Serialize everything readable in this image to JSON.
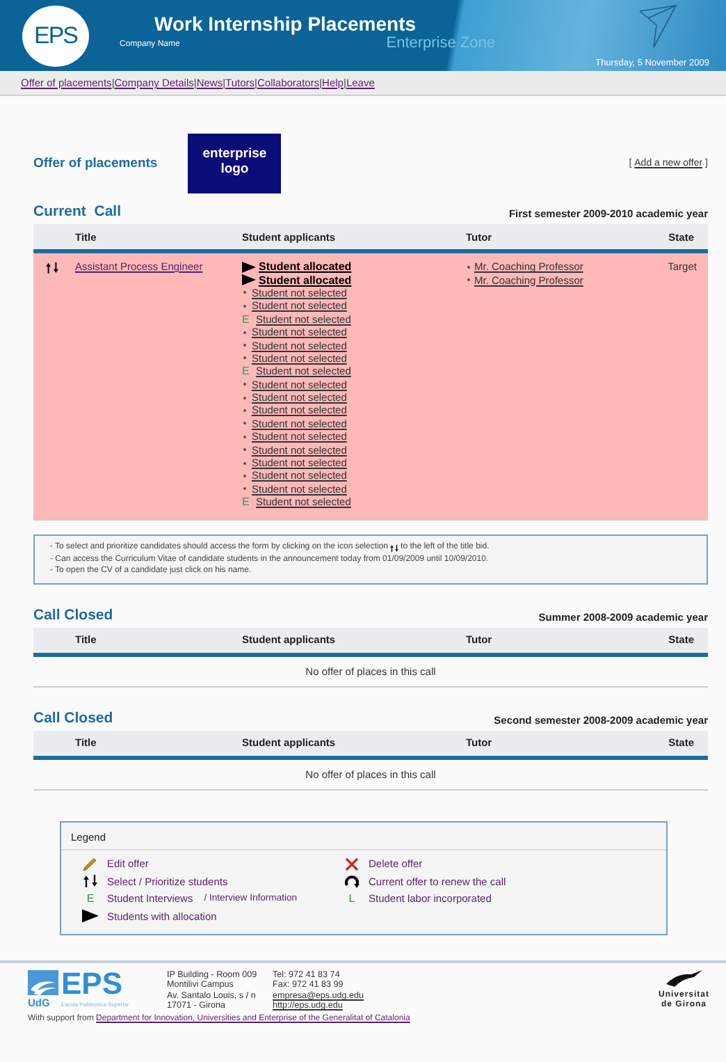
{
  "header": {
    "logo": "EPS",
    "title": "Work Internship Placements",
    "subtitle": "Enterprise Zone",
    "company": "Company Name",
    "date": "Thursday, 5 November 2009"
  },
  "nav": [
    {
      "label": "Offer of placements",
      "separator": "|"
    },
    {
      "label": "Company Details",
      "separator": "|"
    },
    {
      "label": "News",
      "separator": "|"
    },
    {
      "label": "Tutors ",
      "separator": "|"
    },
    {
      "label": "Collaborators",
      "separator": "|"
    },
    {
      "label": "Help",
      "separator": "|"
    },
    {
      "label": "Leave"
    }
  ],
  "page": {
    "heading": "Offer of placements",
    "logo_text": "enterprise logo",
    "add_open": "[",
    "add_link": "Add a new offer",
    "add_close": "]"
  },
  "current_call": {
    "heading": "Current  Call",
    "period": "First semester 2009-2010 academic year",
    "columns": [
      "Title",
      "Student applicants",
      "Tutor",
      "State"
    ],
    "offers": [
      {
        "title": "Assistant Process Engineer",
        "state": "Target",
        "tutors": [
          "Mr. Coaching Professor",
          "Mr. Coaching Professor"
        ],
        "applicants": [
          {
            "kind": "allocated",
            "name": "Student allocated"
          },
          {
            "kind": "allocated",
            "name": "Student allocated"
          },
          {
            "kind": "not_selected",
            "name": "Student not selected"
          },
          {
            "kind": "not_selected",
            "name": "Student not selected"
          },
          {
            "kind": "interview",
            "marker": "E",
            "name": "Student not selected"
          },
          {
            "kind": "not_selected",
            "name": "Student not selected"
          },
          {
            "kind": "not_selected",
            "name": "Student not selected"
          },
          {
            "kind": "not_selected",
            "name": "Student not selected"
          },
          {
            "kind": "interview",
            "marker": "E",
            "name": "Student not selected"
          },
          {
            "kind": "not_selected",
            "name": "Student not selected"
          },
          {
            "kind": "not_selected",
            "name": "Student not selected"
          },
          {
            "kind": "not_selected",
            "name": "Student not selected"
          },
          {
            "kind": "not_selected",
            "name": "Student not selected"
          },
          {
            "kind": "not_selected",
            "name": "Student not selected"
          },
          {
            "kind": "not_selected",
            "name": "Student not selected"
          },
          {
            "kind": "not_selected",
            "name": "Student not selected"
          },
          {
            "kind": "not_selected",
            "name": "Student not selected"
          },
          {
            "kind": "not_selected",
            "name": "Student not selected"
          },
          {
            "kind": "interview",
            "marker": "E",
            "name": "Student not selected"
          }
        ]
      }
    ]
  },
  "notes": [
    {
      "before": "- To select and prioritize candidates should access the form by clicking on the icon selection",
      "kind": "with_icon",
      "after": "to the left of the title bid."
    },
    {
      "before": "- Can access the Curriculum Vitae of candidate students in the announcement today from 01/09/2009 until 10/09/2010."
    },
    {
      "before": "- To open the CV of a candidate just click on his name."
    }
  ],
  "closed_calls": [
    {
      "heading": "Call Closed",
      "period": "Summer 2008-2009 academic year",
      "columns": [
        "Title",
        "Student applicants",
        "Tutor",
        "State"
      ],
      "empty_text": "No offer of places in this call"
    },
    {
      "heading": "Call Closed",
      "period": "Second semester 2008-2009 academic year",
      "columns": [
        "Title",
        "Student applicants",
        "Tutor",
        "State"
      ],
      "empty_text": "No offer of places in this call"
    }
  ],
  "legend": {
    "title": "Legend",
    "items": [
      {
        "kind": "pencil",
        "label": "Edit offer"
      },
      {
        "kind": "cross",
        "label": "Delete offer"
      },
      {
        "kind": "select",
        "label": "Select / Prioritize students"
      },
      {
        "kind": "renew",
        "label": "Current offer to renew the call"
      },
      {
        "kind": "letter",
        "glyph": "E",
        "label": "Student Interviews",
        "extra": "/ Interview Information"
      },
      {
        "kind": "letter",
        "glyph": "L",
        "label": "Student labor incorporated"
      },
      {
        "kind": "triangle",
        "label": "Students with allocation"
      }
    ]
  },
  "footer": {
    "logo": "EPS",
    "logo_sub": "UdG",
    "logo_school": "Escola Politècnica Superior",
    "address": [
      "IP Building - Room 009",
      "Montilivi Campus",
      "Av. Santalo Louis, s / n",
      "17071 - Girona"
    ],
    "phone": "Tel: 972 41 83 74",
    "fax": "Fax: 972 41 83 99",
    "email": "empresa@eps.udg.edu",
    "web": "http://eps.udg.edu",
    "university": [
      "Universitat",
      "de Girona"
    ],
    "support_text": "With support from",
    "support_link": "Department for Innovation, Universities and Enterprise of the Generalitat of Catalonia"
  }
}
